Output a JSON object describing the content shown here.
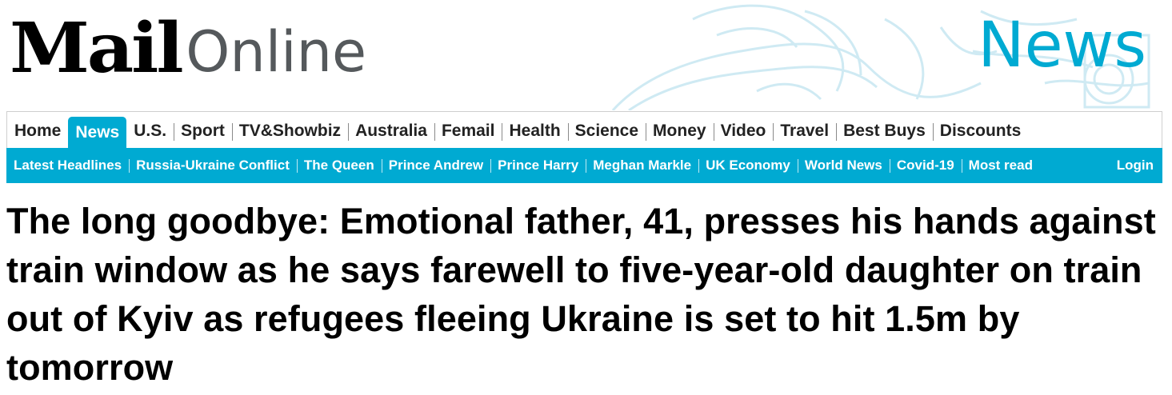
{
  "brand": {
    "logo_mail": "Mail",
    "logo_online": "Online",
    "channel": "News",
    "accent_color": "#00aad2"
  },
  "primary_nav": {
    "items": [
      {
        "label": "Home",
        "active": false
      },
      {
        "label": "News",
        "active": true
      },
      {
        "label": "U.S.",
        "active": false
      },
      {
        "label": "Sport",
        "active": false
      },
      {
        "label": "TV&Showbiz",
        "active": false
      },
      {
        "label": "Australia",
        "active": false
      },
      {
        "label": "Femail",
        "active": false
      },
      {
        "label": "Health",
        "active": false
      },
      {
        "label": "Science",
        "active": false
      },
      {
        "label": "Money",
        "active": false
      },
      {
        "label": "Video",
        "active": false
      },
      {
        "label": "Travel",
        "active": false
      },
      {
        "label": "Best Buys",
        "active": false
      },
      {
        "label": "Discounts",
        "active": false
      }
    ]
  },
  "sub_nav": {
    "items": [
      {
        "label": "Latest Headlines"
      },
      {
        "label": "Russia-Ukraine Conflict"
      },
      {
        "label": "The Queen"
      },
      {
        "label": "Prince Andrew"
      },
      {
        "label": "Prince Harry"
      },
      {
        "label": "Meghan Markle"
      },
      {
        "label": "UK Economy"
      },
      {
        "label": "World News"
      },
      {
        "label": "Covid-19"
      },
      {
        "label": "Most read"
      }
    ],
    "login_label": "Login"
  },
  "article": {
    "headline": "The long goodbye: Emotional father, 41, presses his hands against train window as he says farewell to five-year-old daughter on train out of Kyiv as refugees fleeing Ukraine is set to hit 1.5m by tomorrow"
  }
}
